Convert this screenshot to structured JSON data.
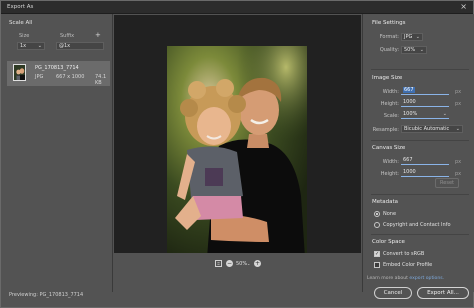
{
  "window": {
    "title": "Export As",
    "close_glyph": "×"
  },
  "left_panel": {
    "heading": "Scale All",
    "size_label": "Size",
    "suffix_label": "Suffix",
    "add_icon": "+",
    "size_value": "1x",
    "suffix_value": "@1x",
    "asset": {
      "name": "PG_170813_7714",
      "format": "JPG",
      "dimensions": "667 x 1000",
      "filesize": "74.1 KB"
    }
  },
  "zoom": {
    "value": "50%"
  },
  "file_settings": {
    "heading": "File Settings",
    "format_label": "Format:",
    "format_value": "JPG",
    "quality_label": "Quality:",
    "quality_value": "50%"
  },
  "image_size": {
    "heading": "Image Size",
    "width_label": "Width:",
    "width_value": "667",
    "height_label": "Height:",
    "height_value": "1000",
    "scale_label": "Scale:",
    "scale_value": "100%",
    "resample_label": "Resample:",
    "resample_value": "Bicubic Automatic",
    "unit": "px"
  },
  "canvas_size": {
    "heading": "Canvas Size",
    "width_label": "Width:",
    "width_value": "667",
    "height_label": "Height:",
    "height_value": "1000",
    "unit": "px",
    "reset_label": "Reset"
  },
  "metadata": {
    "heading": "Metadata",
    "option_none": "None",
    "option_copyright": "Copyright and Contact Info"
  },
  "color_space": {
    "heading": "Color Space",
    "convert_label": "Convert to sRGB",
    "embed_label": "Embed Color Profile"
  },
  "learn_more": {
    "prefix": "Learn more about ",
    "link": "export options."
  },
  "footer": {
    "previewing": "Previewing: PG_170813_7714",
    "cancel_label": "Cancel",
    "export_label": "Export All..."
  }
}
